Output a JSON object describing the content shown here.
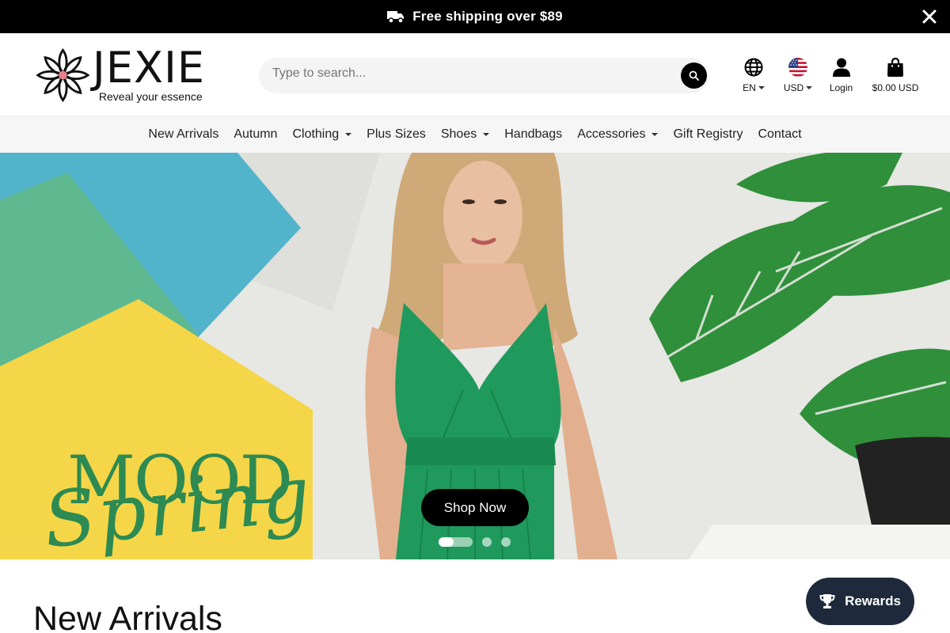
{
  "announcement": {
    "text": "Free shipping over $89",
    "truck_icon": "truck-icon",
    "close_icon": "close-icon"
  },
  "header": {
    "logo": {
      "brand": "JEXIE",
      "tagline": "Reveal your essence",
      "flower_icon": "flower-logo-icon",
      "accent": "#e8808a"
    },
    "search": {
      "placeholder": "Type to search...",
      "button_icon": "search-icon"
    },
    "language": {
      "label": "EN",
      "icon": "globe-icon"
    },
    "currency": {
      "label": "USD",
      "icon": "us-flag-icon"
    },
    "account": {
      "label": "Login",
      "icon": "user-icon"
    },
    "cart": {
      "label": "$0.00 USD",
      "icon": "shopping-bag-icon"
    }
  },
  "nav": {
    "items": [
      {
        "label": "New Arrivals",
        "dropdown": false
      },
      {
        "label": "Autumn",
        "dropdown": false
      },
      {
        "label": "Clothing",
        "dropdown": true
      },
      {
        "label": "Plus Sizes",
        "dropdown": false
      },
      {
        "label": "Shoes",
        "dropdown": true
      },
      {
        "label": "Handbags",
        "dropdown": false
      },
      {
        "label": "Accessories",
        "dropdown": true
      },
      {
        "label": "Gift Registry",
        "dropdown": false
      },
      {
        "label": "Contact",
        "dropdown": false
      }
    ]
  },
  "hero": {
    "headline_script": "Spring",
    "headline": "MOOD",
    "cta": "Shop Now",
    "slides_total": 3,
    "active_slide": 1,
    "active_progress": 0.45,
    "colors": {
      "green": "#2c8a52",
      "teal": "#4fb2c9",
      "mint": "#5eb88e",
      "yellow": "#f5d548",
      "dress": "#1f9a5c"
    }
  },
  "section": {
    "title": "New Arrivals",
    "highlight": "#f7c9d4"
  },
  "rewards": {
    "label": "Rewards",
    "icon": "trophy-icon",
    "background": "#1e2a3b"
  }
}
